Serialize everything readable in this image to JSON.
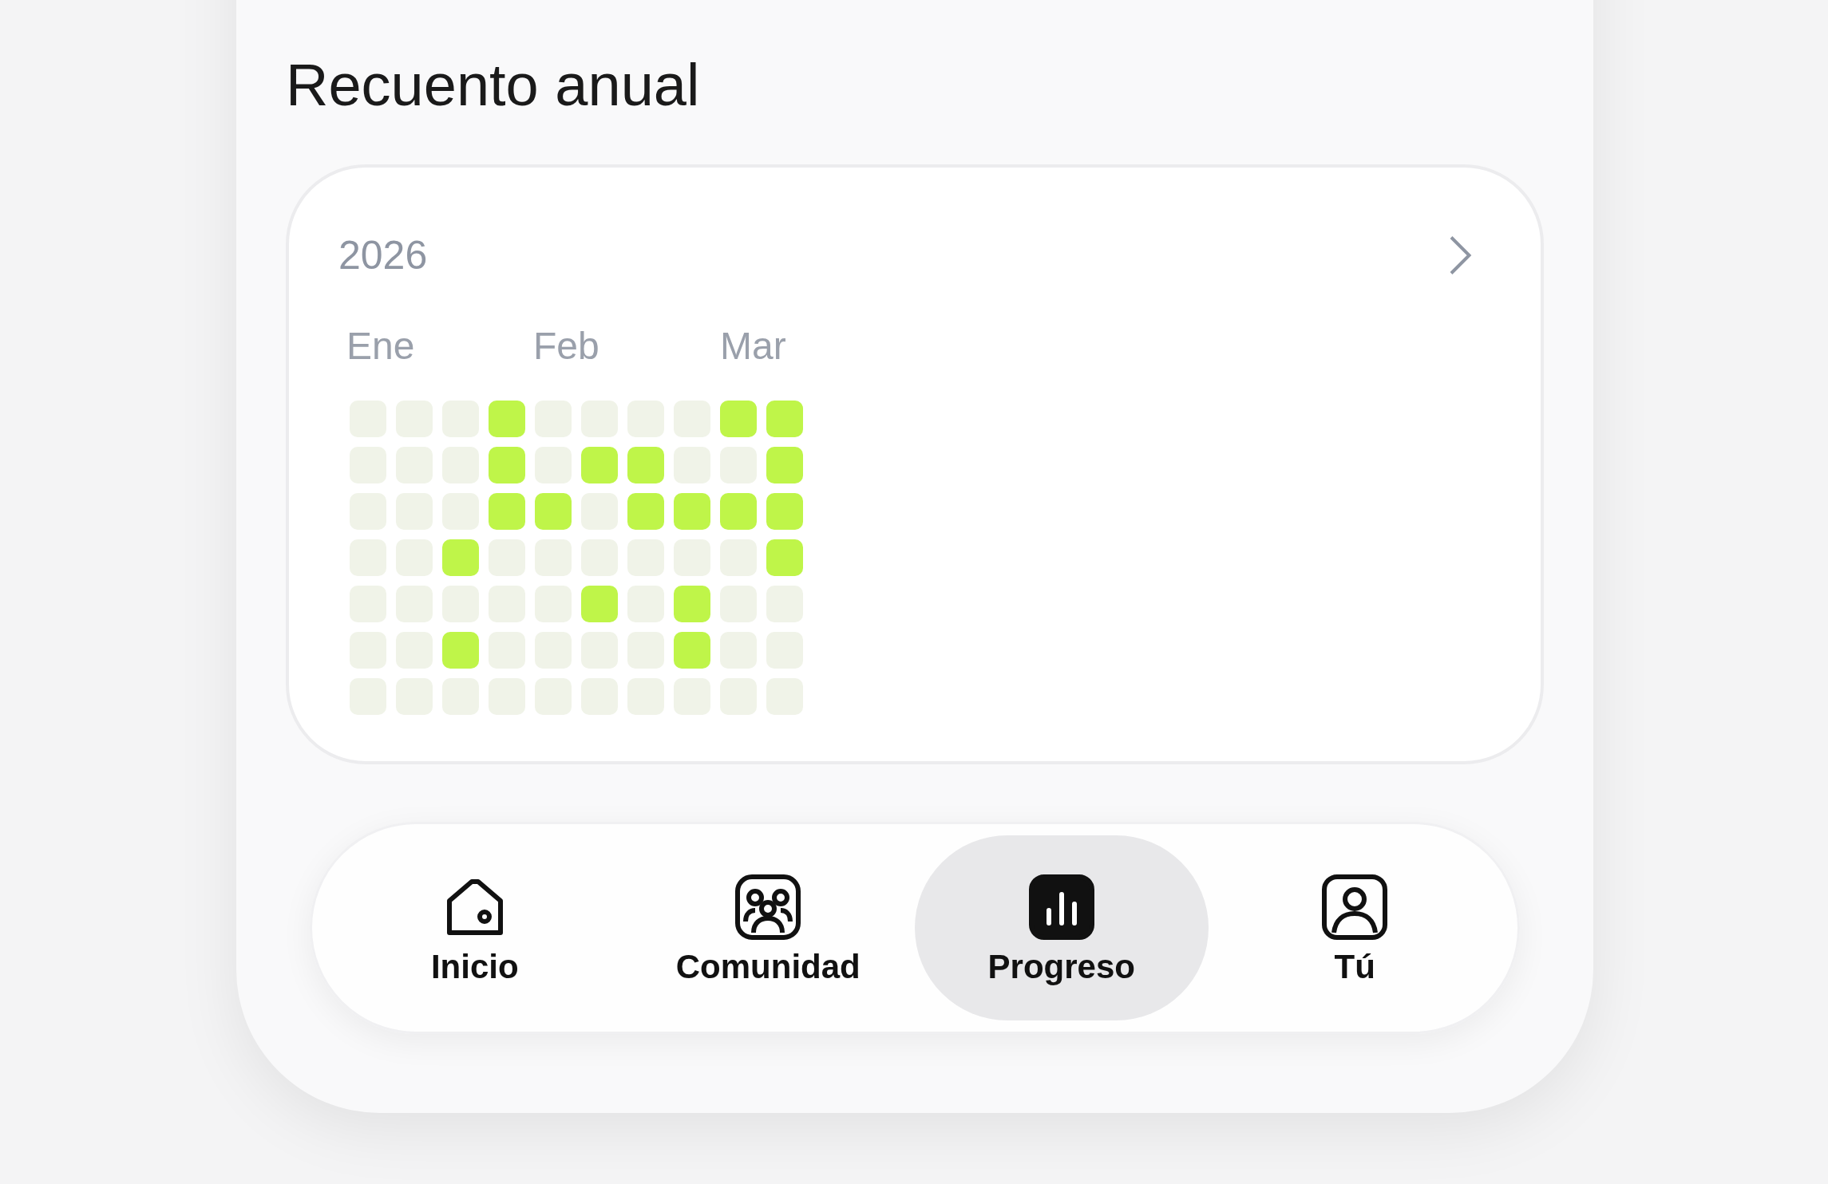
{
  "title": "Recuento anual",
  "calendar": {
    "year": "2026",
    "months": [
      "Ene",
      "Feb",
      "Mar"
    ],
    "grid": [
      [
        false,
        false,
        false,
        true,
        false,
        false,
        false,
        false,
        true,
        true
      ],
      [
        false,
        false,
        false,
        true,
        false,
        true,
        true,
        false,
        false,
        true
      ],
      [
        false,
        false,
        false,
        true,
        true,
        false,
        true,
        true,
        true,
        true
      ],
      [
        false,
        false,
        true,
        false,
        false,
        false,
        false,
        false,
        false,
        true
      ],
      [
        false,
        false,
        false,
        false,
        false,
        true,
        false,
        true,
        false,
        false
      ],
      [
        false,
        false,
        true,
        false,
        false,
        false,
        false,
        true,
        false,
        false
      ],
      [
        false,
        false,
        false,
        false,
        false,
        false,
        false,
        false,
        false,
        false
      ]
    ]
  },
  "nav": [
    {
      "label": "Inicio",
      "kind": "home",
      "selected": false
    },
    {
      "label": "Comunidad",
      "kind": "community",
      "selected": false
    },
    {
      "label": "Progreso",
      "kind": "progress",
      "selected": true
    },
    {
      "label": "Tú",
      "kind": "profile",
      "selected": false
    }
  ]
}
